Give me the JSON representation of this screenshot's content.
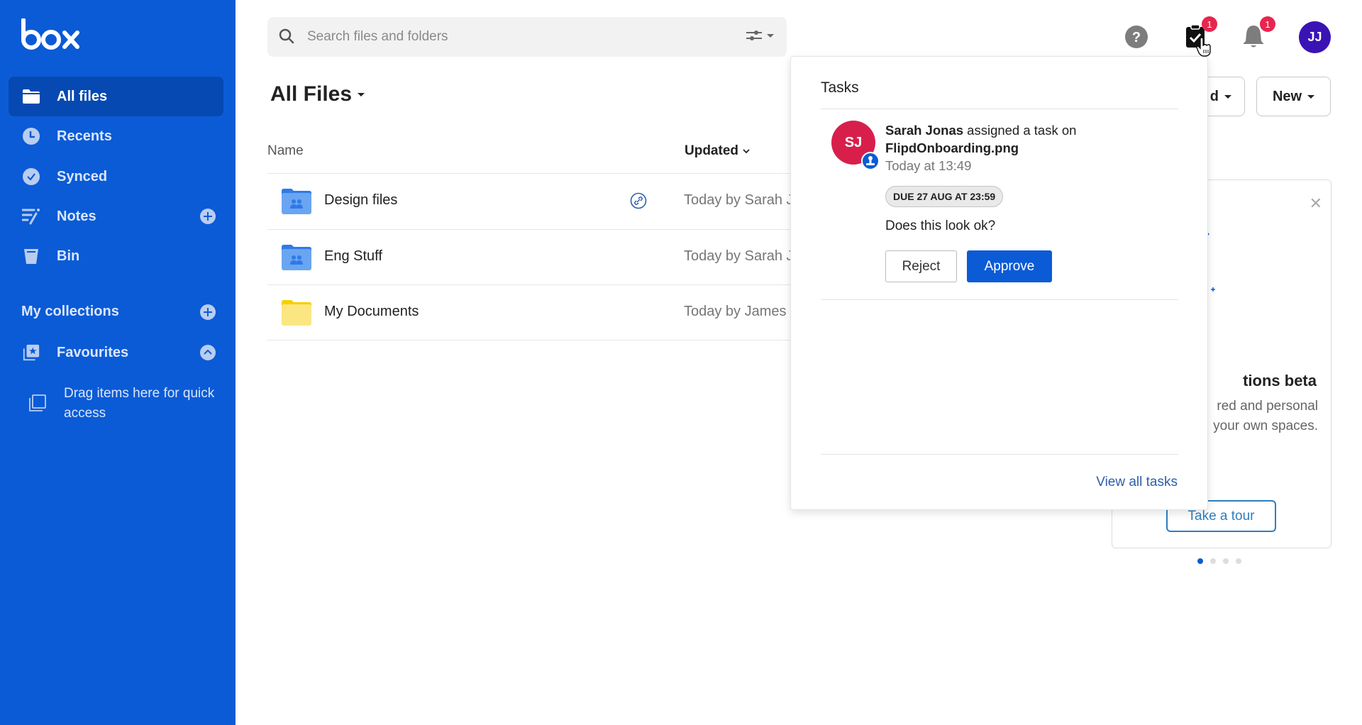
{
  "brand": {
    "logo_text": "box",
    "color": "#0b5bd6"
  },
  "sidebar": {
    "items": [
      {
        "label": "All files",
        "icon": "folder-icon",
        "active": true
      },
      {
        "label": "Recents",
        "icon": "clock-icon"
      },
      {
        "label": "Synced",
        "icon": "check-circle-icon"
      },
      {
        "label": "Notes",
        "icon": "notes-icon",
        "action": "add-icon"
      },
      {
        "label": "Bin",
        "icon": "trash-icon"
      }
    ],
    "collections_label": "My collections",
    "favourites_label": "Favourites",
    "drag_hint": "Drag items here for quick access"
  },
  "search": {
    "placeholder": "Search files and folders",
    "value": ""
  },
  "header": {
    "title": "All Files",
    "upload_label": "Upload",
    "upload_visible_label": "d",
    "new_label": "New",
    "tasks_badge": "1",
    "notifications_badge": "1",
    "user_initials": "JJ"
  },
  "table": {
    "columns": {
      "name": "Name",
      "updated": "Updated"
    },
    "rows": [
      {
        "name": "Design files",
        "updated": "Today by Sarah J",
        "type": "shared-folder",
        "shared_link": true
      },
      {
        "name": "Eng Stuff",
        "updated": "Today by Sarah J",
        "type": "shared-folder",
        "shared_link": false
      },
      {
        "name": "My Documents",
        "updated": "Today by James J",
        "type": "personal-folder",
        "shared_link": false
      }
    ]
  },
  "tasks_panel": {
    "title": "Tasks",
    "task": {
      "assigner_initials": "SJ",
      "assigner": "Sarah Jonas",
      "action_text": "assigned a task on",
      "file": "FlipdOnboarding.png",
      "time": "Today at 13:49",
      "due": "DUE 27 AUG AT 23:59",
      "message": "Does this look ok?",
      "reject_label": "Reject",
      "approve_label": "Approve"
    },
    "view_all_label": "View all tasks"
  },
  "promo": {
    "title": "Collections beta",
    "visible_title": "tions beta",
    "description_lines": [
      "red and personal",
      "your own spaces."
    ],
    "tour_label": "Take a tour",
    "page_count": 4,
    "current_page": 1
  }
}
